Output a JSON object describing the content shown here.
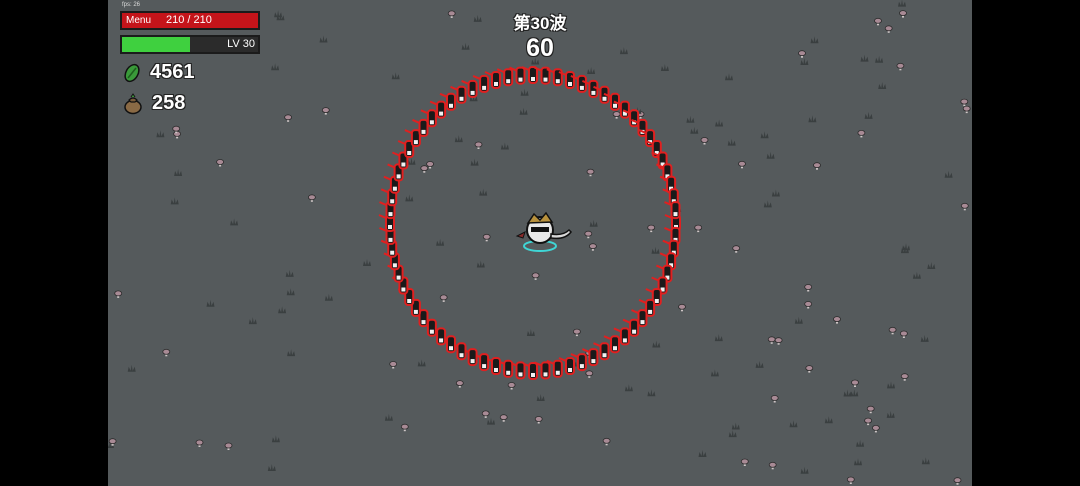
{
  "hud": {
    "fps": "fps: 26",
    "menu_label": "Menu",
    "hp_text": "210 / 210",
    "hp_fraction": 1.0,
    "level_text": "LV 30",
    "xp_fraction": 0.5,
    "materials": "4561",
    "bag": "258"
  },
  "wave": {
    "label": "第30波",
    "timer": "60"
  },
  "icons": {
    "materials": "green-leaf-material-icon",
    "bag": "money-bag-icon"
  },
  "colors": {
    "ground": "#555a5c",
    "hp": "#c4141a",
    "xp": "#3fd03f",
    "enemy_outline": "#e02020"
  },
  "enemies": {
    "ring_count": 72
  }
}
